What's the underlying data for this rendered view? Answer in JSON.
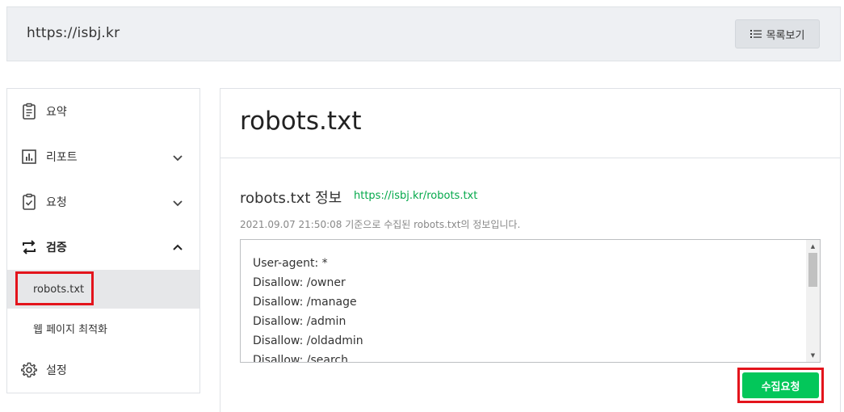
{
  "header": {
    "url": "https://isbj.kr",
    "list_button_label": "목록보기"
  },
  "sidebar": {
    "items": [
      {
        "label": "요약",
        "icon": "clipboard-icon"
      },
      {
        "label": "리포트",
        "icon": "bar-chart-icon",
        "expanded": false
      },
      {
        "label": "요청",
        "icon": "clipboard-check-icon",
        "expanded": false
      },
      {
        "label": "검증",
        "icon": "swap-arrows-icon",
        "expanded": true
      },
      {
        "label": "설정",
        "icon": "gear-icon"
      }
    ],
    "sub_items": [
      {
        "label": "robots.txt",
        "active": true
      },
      {
        "label": "웹 페이지 최적화",
        "active": false
      }
    ]
  },
  "main": {
    "title": "robots.txt",
    "section_title": "robots.txt 정보",
    "section_link": "https://isbj.kr/robots.txt",
    "info": "2021.09.07 21:50:08 기준으로 수집된 robots.txt의 정보입니다.",
    "robots_lines": [
      "User-agent: *",
      "Disallow: /owner",
      "Disallow: /manage",
      "Disallow: /admin",
      "Disallow: /oldadmin",
      "Disallow: /search"
    ],
    "collect_button_label": "수집요청"
  },
  "colors": {
    "accent_green": "#03c75a",
    "link_green": "#03a84a",
    "highlight_red": "#e3141c"
  }
}
